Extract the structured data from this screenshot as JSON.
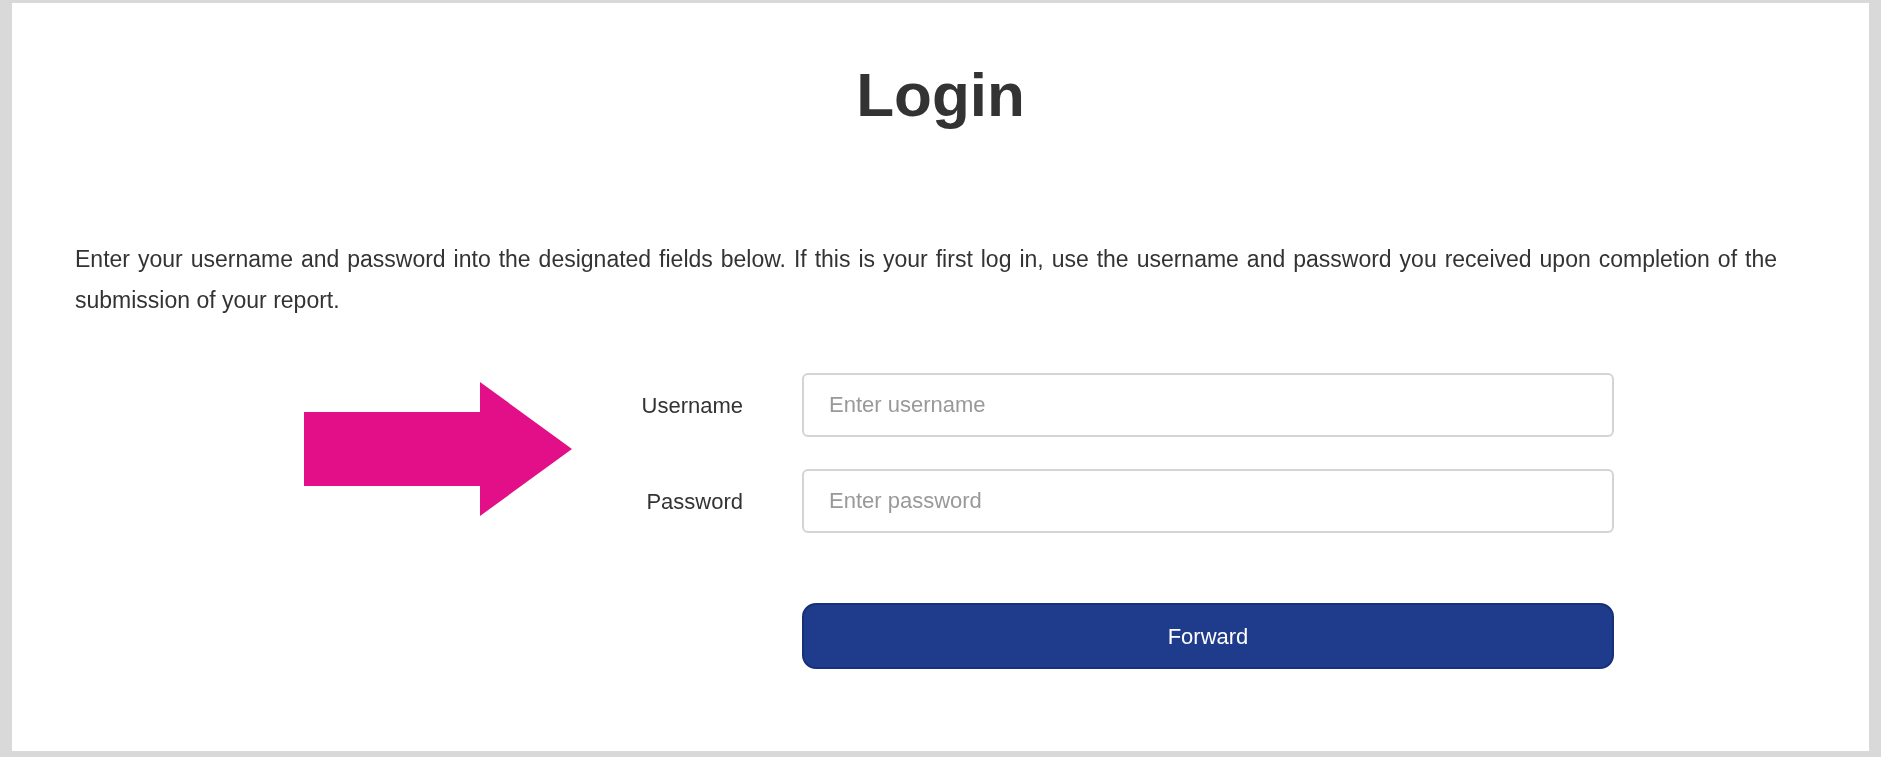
{
  "title": "Login",
  "instructions": "Enter your username and password into the designated fields below. If this is your first log in, use the username and password you received upon completion of the submission of your report.",
  "fields": [
    {
      "label": "Username",
      "placeholder": "Enter username"
    },
    {
      "label": "Password",
      "placeholder": "Enter password"
    }
  ],
  "submit": {
    "label": "Forward"
  }
}
